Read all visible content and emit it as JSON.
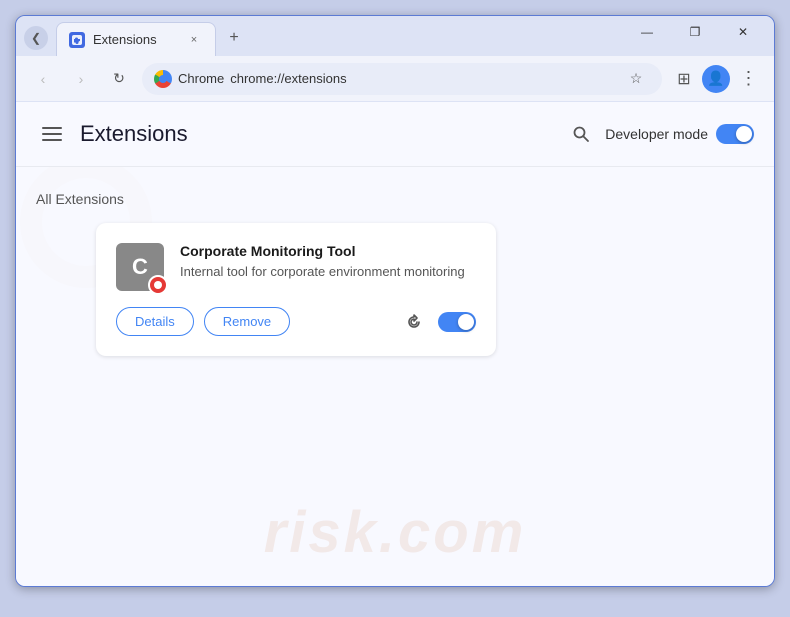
{
  "browser": {
    "tab": {
      "favicon_label": "E",
      "title": "Extensions",
      "close_label": "×"
    },
    "new_tab_label": "+",
    "tab_arrow_label": "❮",
    "window_controls": {
      "minimize": "—",
      "maximize": "❐",
      "close": "✕"
    },
    "nav": {
      "back_label": "‹",
      "forward_label": "›",
      "reload_label": "↻",
      "chrome_brand": "Chrome",
      "address": "chrome://extensions",
      "star_label": "☆",
      "extensions_label": "⊞",
      "profile_label": "👤",
      "menu_label": "⋮"
    }
  },
  "extensions_page": {
    "hamburger_label": "☰",
    "title": "Extensions",
    "search_label": "🔍",
    "developer_mode_label": "Developer mode",
    "section_title": "All Extensions",
    "extension": {
      "icon_letter": "C",
      "name": "Corporate Monitoring Tool",
      "description": "Internal tool for corporate environment monitoring",
      "details_button": "Details",
      "remove_button": "Remove",
      "enabled": true
    }
  },
  "watermark": {
    "text": "risk.com"
  }
}
